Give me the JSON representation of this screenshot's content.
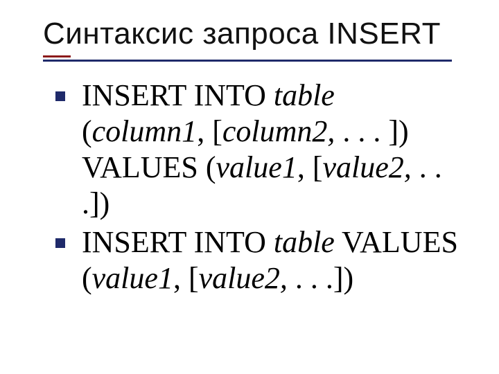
{
  "title": "Синтаксис запроса INSERT",
  "items": [
    {
      "seg1": "INSERT INTO ",
      "seg1_i": "table",
      "seg2a": " (",
      "seg2_i1": "column1",
      "seg2b": ", [",
      "seg2_i2": "column2, ",
      "seg2c": ". . . ]) VALUES (",
      "seg2_i3": "value1",
      "seg2d": ", [",
      "seg2_i4": "value2, ",
      "seg2e": ". . .])"
    },
    {
      "seg1": "INSERT INTO ",
      "seg1_i": "table",
      "seg2a": " VALUES (",
      "seg2_i1": "value1",
      "seg2b": ", [",
      "seg2_i2": "value2, ",
      "seg2c": ". . .])"
    }
  ]
}
